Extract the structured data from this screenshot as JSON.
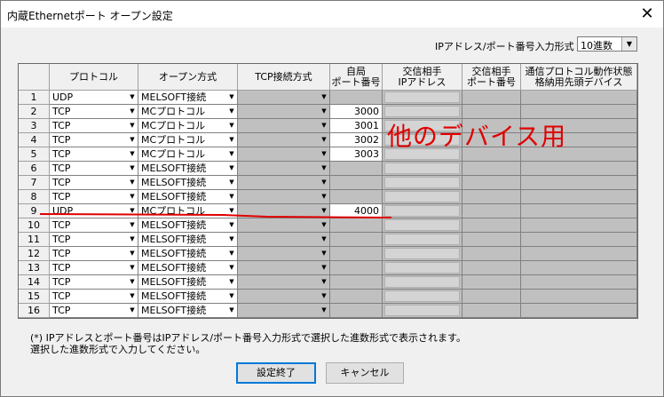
{
  "window": {
    "title": "内蔵Ethernetポート オープン設定",
    "close_label": "✕"
  },
  "format": {
    "label": "IPアドレス/ポート番号入力形式",
    "value": "10進数"
  },
  "headers": {
    "protocol": "プロトコル",
    "open_method": "オープン方式",
    "tcp_method": "TCP接続方式",
    "own_port": "自局\nポート番号",
    "peer_ip": "交信相手\nIPアドレス",
    "peer_port": "交信相手\nポート番号",
    "status_device": "通信プロトコル動作状態\n格納用先頭デバイス"
  },
  "rows": [
    {
      "no": "1",
      "protocol": "UDP",
      "open": "MELSOFT接続",
      "port": ""
    },
    {
      "no": "2",
      "protocol": "TCP",
      "open": "MCプロトコル",
      "port": "3000"
    },
    {
      "no": "3",
      "protocol": "TCP",
      "open": "MCプロトコル",
      "port": "3001"
    },
    {
      "no": "4",
      "protocol": "TCP",
      "open": "MCプロトコル",
      "port": "3002"
    },
    {
      "no": "5",
      "protocol": "TCP",
      "open": "MCプロトコル",
      "port": "3003"
    },
    {
      "no": "6",
      "protocol": "TCP",
      "open": "MELSOFT接続",
      "port": ""
    },
    {
      "no": "7",
      "protocol": "TCP",
      "open": "MELSOFT接続",
      "port": ""
    },
    {
      "no": "8",
      "protocol": "TCP",
      "open": "MELSOFT接続",
      "port": ""
    },
    {
      "no": "9",
      "protocol": "UDP",
      "open": "MCプロトコル",
      "port": "4000"
    },
    {
      "no": "10",
      "protocol": "TCP",
      "open": "MELSOFT接続",
      "port": ""
    },
    {
      "no": "11",
      "protocol": "TCP",
      "open": "MELSOFT接続",
      "port": ""
    },
    {
      "no": "12",
      "protocol": "TCP",
      "open": "MELSOFT接続",
      "port": ""
    },
    {
      "no": "13",
      "protocol": "TCP",
      "open": "MELSOFT接続",
      "port": ""
    },
    {
      "no": "14",
      "protocol": "TCP",
      "open": "MELSOFT接続",
      "port": ""
    },
    {
      "no": "15",
      "protocol": "TCP",
      "open": "MELSOFT接続",
      "port": ""
    },
    {
      "no": "16",
      "protocol": "TCP",
      "open": "MELSOFT接続",
      "port": ""
    }
  ],
  "notes": {
    "line1": "(*) IPアドレスとポート番号はIPアドレス/ポート番号入力形式で選択した進数形式で表示されます。",
    "line2": "選択した進数形式で入力してください。"
  },
  "buttons": {
    "ok": "設定終了",
    "cancel": "キャンセル"
  },
  "annotation": {
    "text": "他のデバイス用",
    "color": "#e00000"
  }
}
